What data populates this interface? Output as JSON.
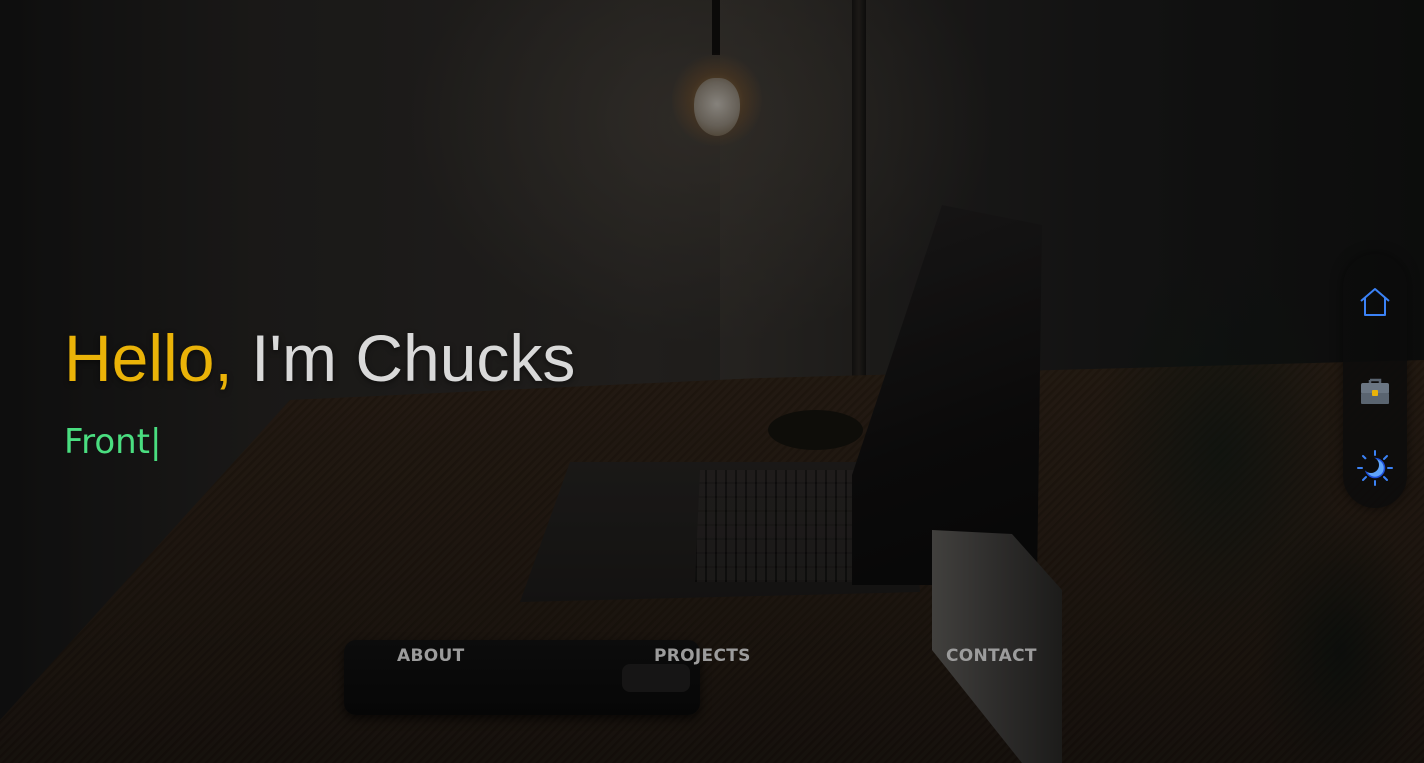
{
  "hero": {
    "greeting": "Hello,",
    "name": " I'm Chucks",
    "typed_text": "Front",
    "caret": "|"
  },
  "nav": {
    "items": [
      {
        "label": "ABOUT"
      },
      {
        "label": "PROJECTS"
      },
      {
        "label": "CONTACT"
      }
    ]
  },
  "dock": {
    "items": [
      {
        "icon": "home-icon"
      },
      {
        "icon": "briefcase-icon"
      },
      {
        "icon": "theme-toggle-icon"
      }
    ]
  },
  "colors": {
    "greeting": "#eab308",
    "name": "#d9d9d9",
    "typed": "#4ade80",
    "nav": "#9c9c9c",
    "icon_accent": "#3b82f6"
  }
}
